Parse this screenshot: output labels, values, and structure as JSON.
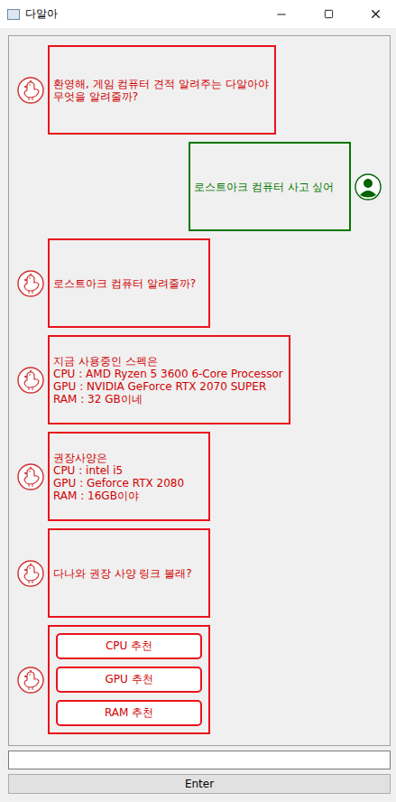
{
  "window": {
    "title": "다알아"
  },
  "messages": [
    {
      "sender": "bot",
      "kind": "text",
      "text": "환영해, 게임 컴퓨터 견적 알려주는 다알아야\n무엇을 알려줄까?"
    },
    {
      "sender": "user",
      "kind": "text",
      "text": "로스트아크 컴퓨터 사고 싶어"
    },
    {
      "sender": "bot",
      "kind": "text",
      "text": "로스트아크 컴퓨터 알려줄까?"
    },
    {
      "sender": "bot",
      "kind": "text",
      "text": "지금 사용중인 스펙은\nCPU : AMD Ryzen 5 3600 6-Core Processor\nGPU : NVIDIA GeForce RTX 2070 SUPER\nRAM : 32 GB이네"
    },
    {
      "sender": "bot",
      "kind": "text",
      "text": "권장사양은\nCPU : intel i5\nGPU : Geforce RTX 2080\nRAM : 16GB이야"
    },
    {
      "sender": "bot",
      "kind": "text",
      "text": "다나와 권장 사양 링크 볼래?"
    },
    {
      "sender": "bot",
      "kind": "buttons",
      "buttons": [
        "CPU 추천",
        "GPU 추천",
        "RAM 추천"
      ]
    }
  ],
  "input": {
    "value": ""
  },
  "submit": "Enter"
}
